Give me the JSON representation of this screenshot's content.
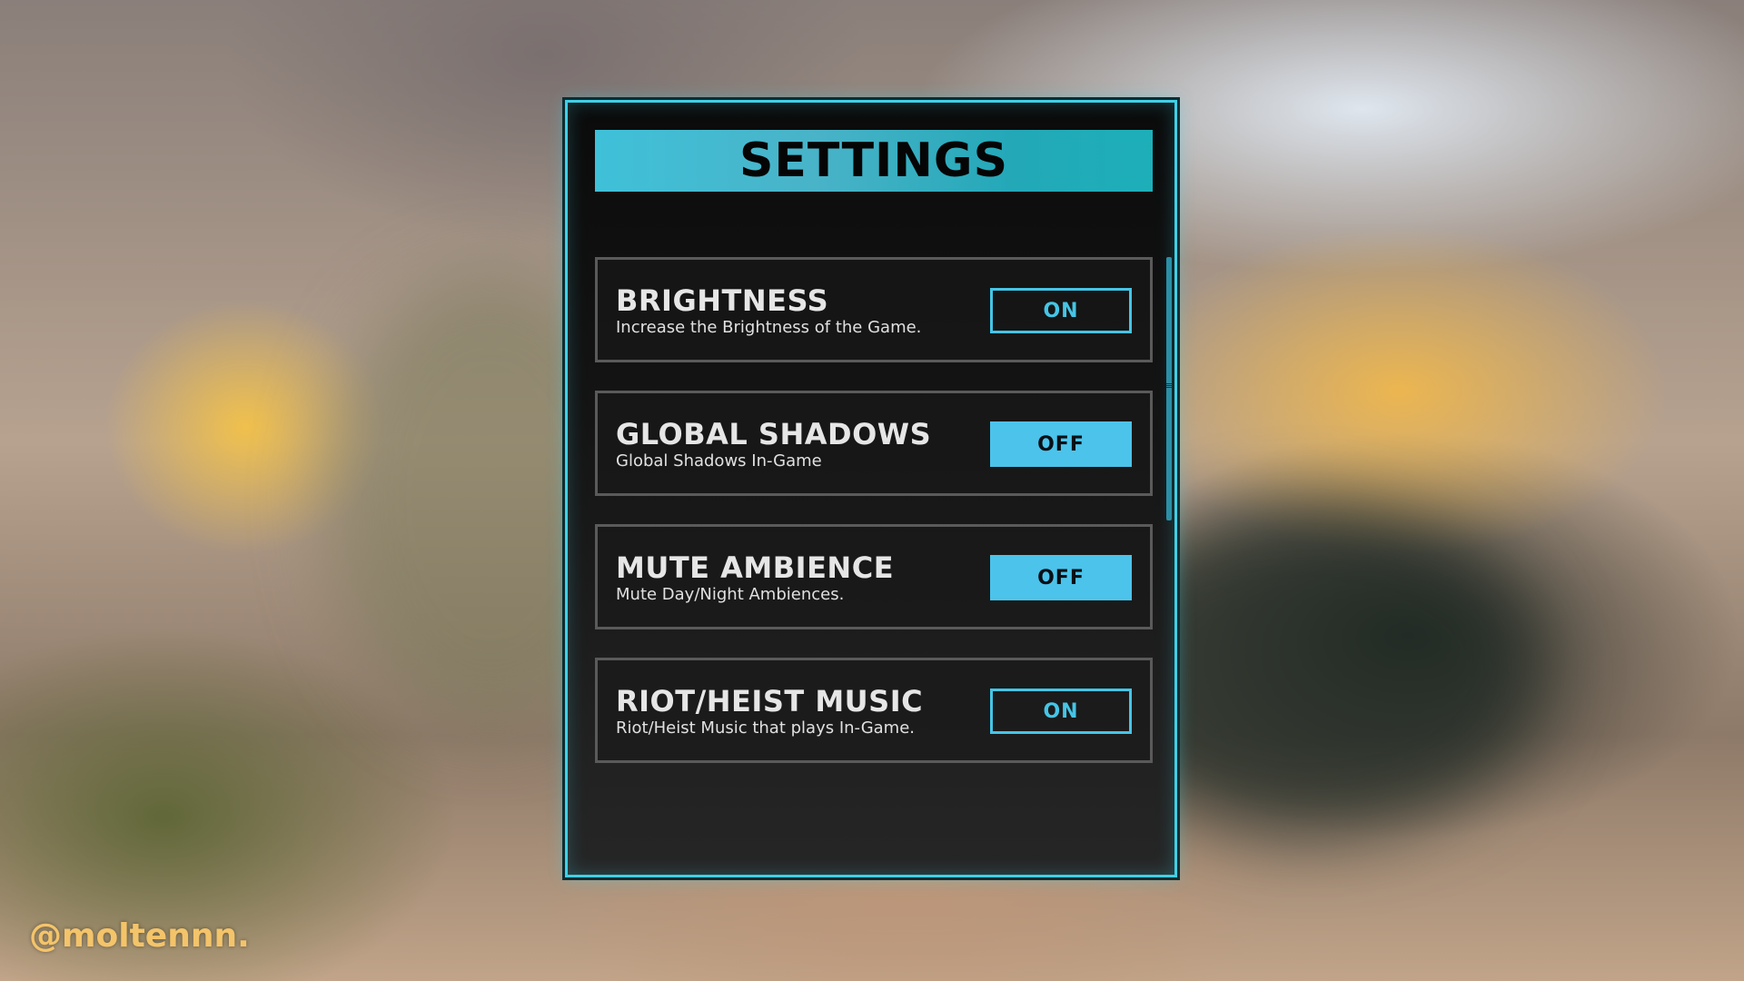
{
  "title": "SETTINGS",
  "settings": [
    {
      "name": "BRIGHTNESS",
      "description": "Increase the Brightness of the Game.",
      "state": "ON"
    },
    {
      "name": "GLOBAL SHADOWS",
      "description": "Global Shadows In-Game",
      "state": "OFF"
    },
    {
      "name": "MUTE AMBIENCE",
      "description": "Mute Day/Night Ambiences.",
      "state": "OFF"
    },
    {
      "name": "RIOT/HEIST MUSIC",
      "description": "Riot/Heist Music that plays In-Game.",
      "state": "ON"
    }
  ],
  "watermark": "@moltennn.",
  "colors": {
    "accent": "#3fd0e6",
    "toggle_on_outline": "#45c5e6",
    "toggle_off_fill": "#4cc3ea",
    "watermark": "#f4c46a"
  }
}
